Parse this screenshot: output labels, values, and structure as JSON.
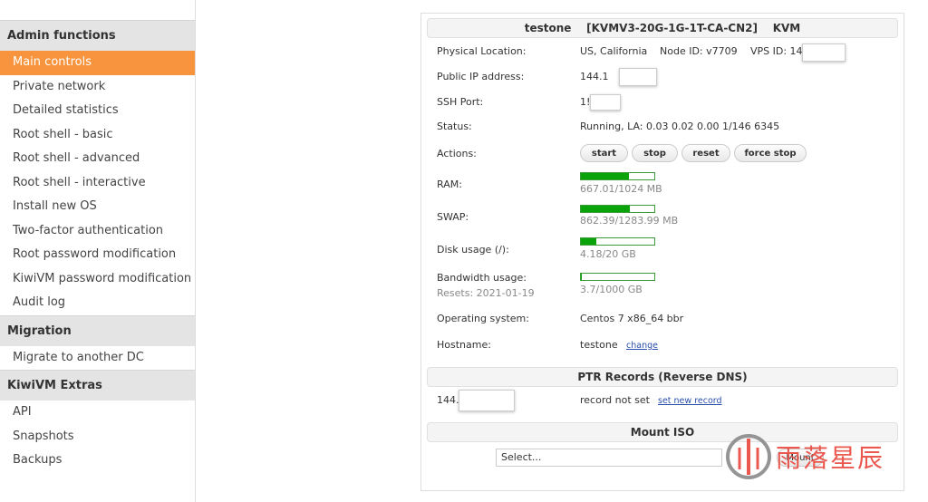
{
  "sidebar": {
    "sections": [
      {
        "title": "Admin functions",
        "items": [
          "Main controls",
          "Private network",
          "Detailed statistics",
          "Root shell - basic",
          "Root shell - advanced",
          "Root shell - interactive",
          "Install new OS",
          "Two-factor authentication",
          "Root password modification",
          "KiwiVM password modification",
          "Audit log"
        ]
      },
      {
        "title": "Migration",
        "items": [
          "Migrate to another DC"
        ]
      },
      {
        "title": "KiwiVM Extras",
        "items": [
          "API",
          "Snapshots",
          "Backups"
        ]
      }
    ],
    "active": "Main controls"
  },
  "header": {
    "title": "testone    [KVMV3-20G-1G-1T-CA-CN2]    KVM"
  },
  "info": {
    "location_label": "Physical Location:",
    "location_value": "US, California",
    "node_text": "Node ID: v7709",
    "vpsid_text": "VPS ID: 14",
    "ip_label": "Public IP address:",
    "ip_value": "144.1",
    "ssh_label": "SSH Port:",
    "ssh_value": "1!",
    "status_label": "Status:",
    "status_value": "Running, LA: 0.03 0.02 0.00 1/146 6345",
    "actions_label": "Actions:",
    "actions": [
      "start",
      "stop",
      "reset",
      "force stop"
    ],
    "ram_label": "RAM:",
    "ram_text": "667.01/1024 MB",
    "ram_fraction": 0.651,
    "swap_label": "SWAP:",
    "swap_text": "862.39/1283.99 MB",
    "swap_fraction": 0.672,
    "disk_label": "Disk usage (/):",
    "disk_text": "4.18/20 GB",
    "disk_fraction": 0.209,
    "bw_label": "Bandwidth usage:",
    "bw_resets": "Resets: 2021-01-19",
    "bw_text": "3.7/1000 GB",
    "bw_fraction": 0.0037,
    "os_label": "Operating system:",
    "os_value": "Centos 7 x86_64 bbr",
    "host_label": "Hostname:",
    "host_value": "testone",
    "host_change": "change"
  },
  "ptr": {
    "title": "PTR Records (Reverse DNS)",
    "ip": "144.",
    "status": "record not set",
    "action": "set new record"
  },
  "iso": {
    "title": "Mount ISO",
    "select_value": "Select...",
    "button": "Mount"
  },
  "watermark": {
    "text": "雨落星辰",
    "color": "#e8473d"
  },
  "colors": {
    "accent": "#f7943d",
    "bar_green": "#0aa30a",
    "link": "#2a4fa8"
  }
}
